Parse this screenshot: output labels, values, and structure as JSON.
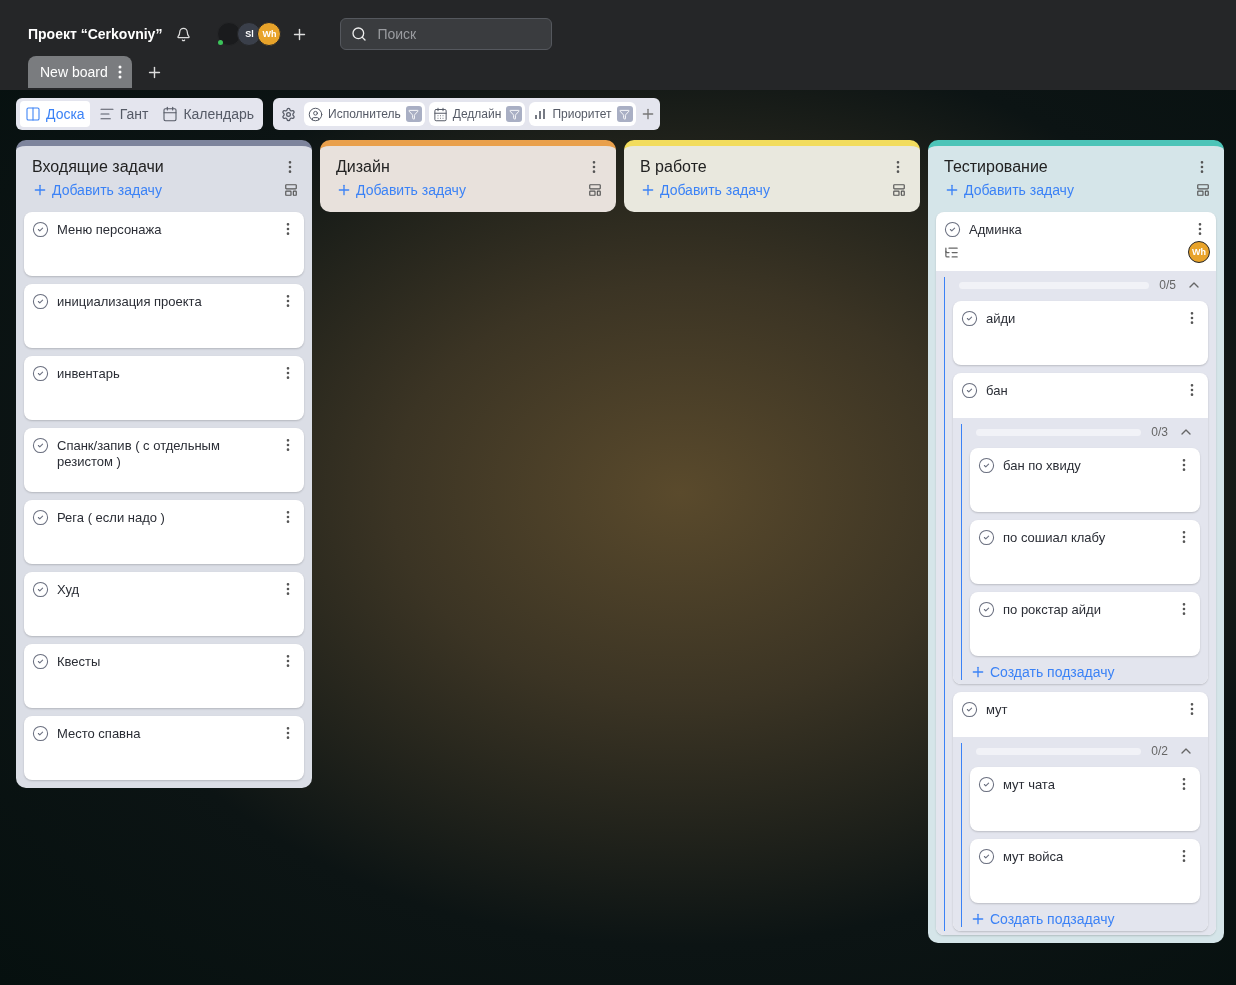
{
  "project": {
    "title": "Проект “Cerkovniy”"
  },
  "members": [
    {
      "kind": "image",
      "online": true
    },
    {
      "kind": "initials",
      "initials": "Sl",
      "color": "#3a3f4a"
    },
    {
      "kind": "initials",
      "initials": "Wh",
      "color": "#e8a32a"
    }
  ],
  "search": {
    "placeholder": "Поиск"
  },
  "boards": [
    {
      "label": "New board",
      "selected": true
    }
  ],
  "views": [
    {
      "label": "Доска",
      "kind": "board",
      "selected": true
    },
    {
      "label": "Гант",
      "kind": "gantt",
      "selected": false
    },
    {
      "label": "Календарь",
      "kind": "calendar",
      "selected": false
    }
  ],
  "filters": [
    {
      "label": "Исполнитель",
      "kind": "assignee"
    },
    {
      "label": "Дедлайн",
      "kind": "deadline"
    },
    {
      "label": "Приоритет",
      "kind": "priority"
    }
  ],
  "columns": [
    {
      "title": "Входящие задачи",
      "color": "#7d849c",
      "add_label": "Добавить задачу",
      "cards": [
        {
          "title": "Меню персонажа"
        },
        {
          "title": "инициализация проекта"
        },
        {
          "title": "инвентарь"
        },
        {
          "title": "Спанк/запив ( с отдельным резистом )"
        },
        {
          "title": "Рега ( если надо )"
        },
        {
          "title": "Худ"
        },
        {
          "title": "Квесты"
        },
        {
          "title": "Место спавна"
        }
      ]
    },
    {
      "title": "Дизайн",
      "color": "#e9a04c",
      "add_label": "Добавить задачу"
    },
    {
      "title": "В работе",
      "color": "#f2dc5d",
      "add_label": "Добавить задачу"
    },
    {
      "title": "Тестирование",
      "color": "#4cc4b8",
      "add_label": "Добавить задачу",
      "cards": [
        {
          "title": "Админка",
          "assignee": {
            "initials": "Wh",
            "color": "#e8a32a"
          },
          "subtasks": {
            "progress": "0/5",
            "level": 0,
            "expanded": true,
            "items": [
              {
                "title": "айди"
              },
              {
                "title": "бан",
                "subtasks": {
                  "progress": "0/3",
                  "level": 0,
                  "expanded": true,
                  "create_label": "Создать подзадачу",
                  "items": [
                    {
                      "title": "бан по хвиду"
                    },
                    {
                      "title": "по сошиал клабу"
                    },
                    {
                      "title": "по рокстар айди"
                    }
                  ]
                }
              },
              {
                "title": "мут",
                "subtasks": {
                  "progress": "0/2",
                  "level": 0,
                  "expanded": true,
                  "create_label": "Создать подзадачу",
                  "items": [
                    {
                      "title": "мут чата"
                    },
                    {
                      "title": "мут войса"
                    }
                  ]
                }
              }
            ]
          }
        }
      ]
    }
  ]
}
